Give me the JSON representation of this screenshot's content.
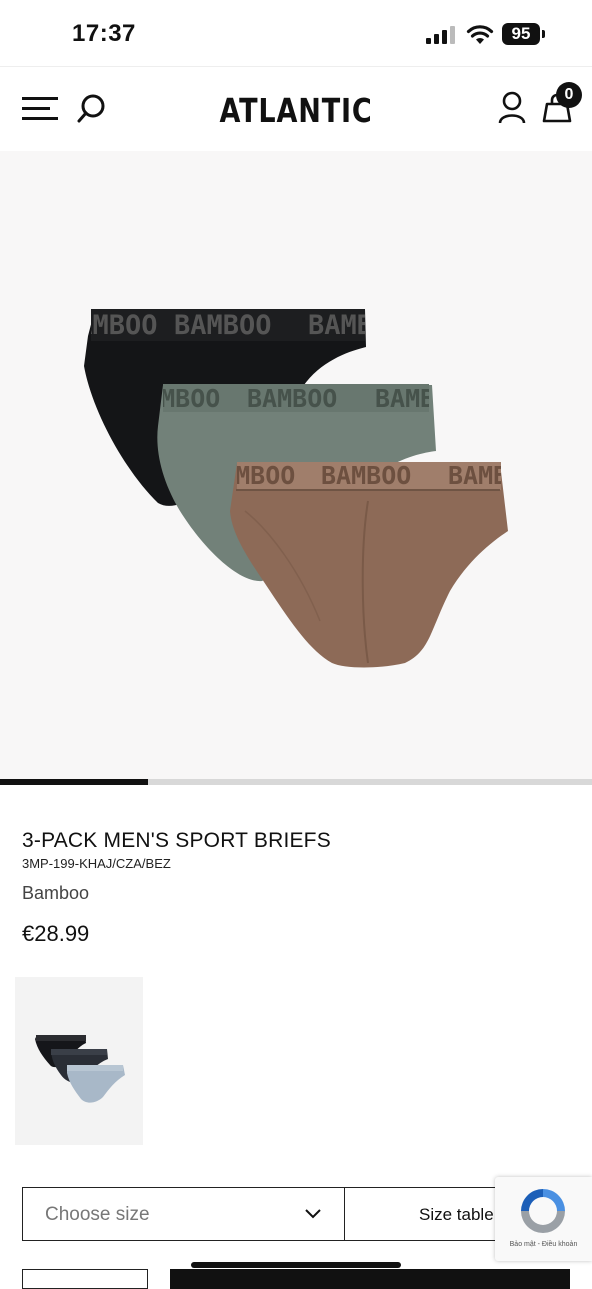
{
  "status_bar": {
    "time": "17:37",
    "battery": "95"
  },
  "header": {
    "logo": "ATLANTIC",
    "cart_count": "0"
  },
  "gallery": {
    "progress": 0.25,
    "band_text": "BAMBOO"
  },
  "product": {
    "title": "3-PACK MEN'S SPORT BRIEFS",
    "sku": "3MP-199-KHAJ/CZA/BEZ",
    "material": "Bamboo",
    "price": "€28.99"
  },
  "size": {
    "choose_label": "Choose size",
    "table_label": "Size table"
  },
  "recaptcha": {
    "text": "Bảo mật - Điều khoản"
  },
  "colors": {
    "black": "#141517",
    "sage": "#728179",
    "brown": "#8d6a57",
    "accent": "#111111"
  }
}
